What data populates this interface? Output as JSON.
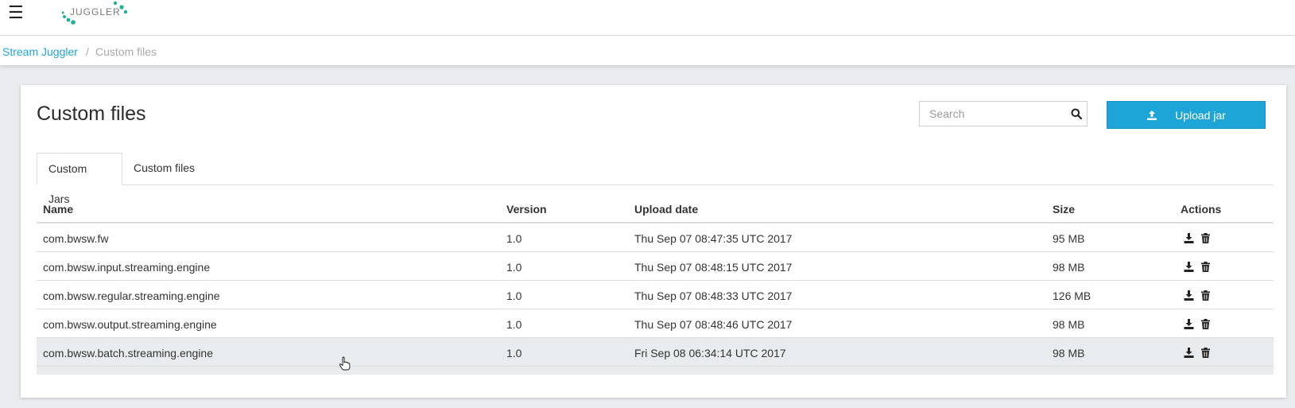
{
  "header": {
    "menu_icon": "hamburger-icon",
    "logo_text": "JUGGLER"
  },
  "breadcrumb": {
    "root": "Stream Juggler",
    "separator": "/",
    "current": "Custom files"
  },
  "page": {
    "title": "Custom files",
    "search_placeholder": "Search",
    "upload_label": "Upload jar"
  },
  "tabs": [
    {
      "label": "Custom Jars",
      "active": true
    },
    {
      "label": "Custom files",
      "active": false
    }
  ],
  "table": {
    "columns": [
      "Name",
      "Version",
      "Upload date",
      "Size",
      "Actions"
    ],
    "rows": [
      {
        "name": "com.bwsw.fw",
        "version": "1.0",
        "date": "Thu Sep 07 08:47:35 UTC 2017",
        "size": "95 MB"
      },
      {
        "name": "com.bwsw.input.streaming.engine",
        "version": "1.0",
        "date": "Thu Sep 07 08:48:15 UTC 2017",
        "size": "98 MB"
      },
      {
        "name": "com.bwsw.regular.streaming.engine",
        "version": "1.0",
        "date": "Thu Sep 07 08:48:33 UTC 2017",
        "size": "126 MB"
      },
      {
        "name": "com.bwsw.output.streaming.engine",
        "version": "1.0",
        "date": "Thu Sep 07 08:48:46 UTC 2017",
        "size": "98 MB"
      },
      {
        "name": "com.bwsw.batch.streaming.engine",
        "version": "1.0",
        "date": "Fri Sep 08 06:34:14 UTC 2017",
        "size": "98 MB"
      }
    ]
  },
  "colors": {
    "accent": "#1ea5d8",
    "logo_dots": "#1ab394"
  }
}
